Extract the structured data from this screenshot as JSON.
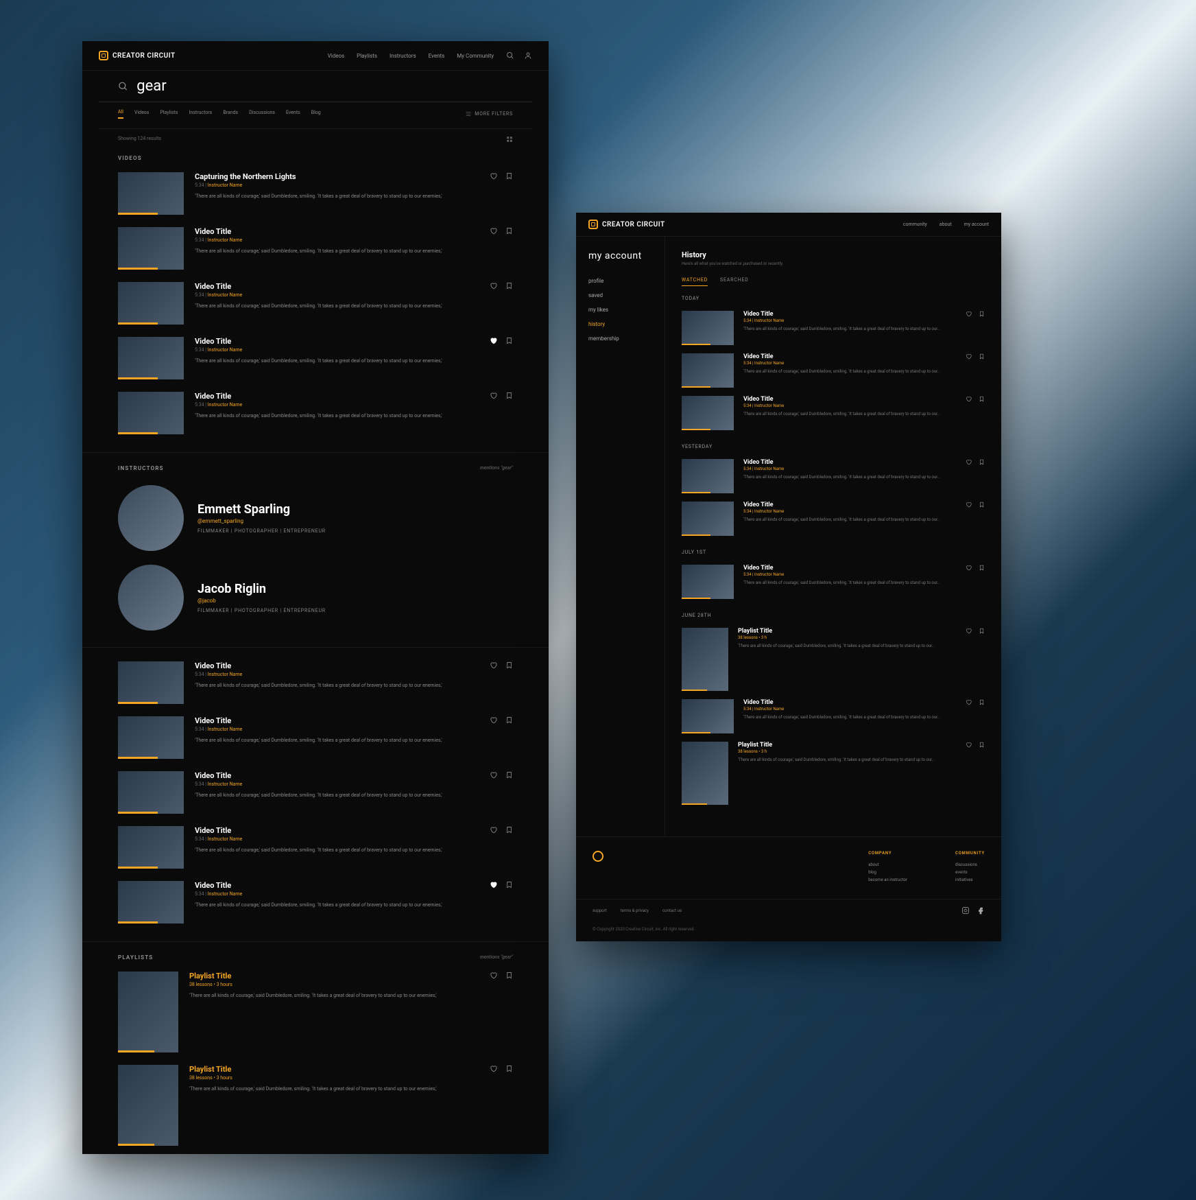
{
  "brand": "CREATOR CIRCUIT",
  "w1": {
    "nav": [
      "Videos",
      "Playlists",
      "Instructors",
      "Events",
      "My Community"
    ],
    "search_value": "gear",
    "tabs": [
      "All",
      "Videos",
      "Playlists",
      "Instructors",
      "Brands",
      "Discussions",
      "Events",
      "Blog"
    ],
    "more_filters": "MORE FILTERS",
    "results_count": "Showing 124 results",
    "sec_videos": "VIDEOS",
    "sec_instructors": "INSTRUCTORS",
    "sec_playlists": "PLAYLISTS",
    "mention": "mentions \"gear\"",
    "desc": "'There are all kinds of courage,' said Dumbledore, smiling. 'It takes a great deal of bravery to stand up to our enemies,'",
    "videos1": [
      {
        "title": "Capturing the Northern Lights",
        "meta_dur": "5:34",
        "meta_by": "Instructor Name",
        "liked": false
      },
      {
        "title": "Video Title",
        "meta_dur": "5:34",
        "meta_by": "Instructor Name",
        "liked": false
      },
      {
        "title": "Video Title",
        "meta_dur": "5:34",
        "meta_by": "Instructor Name",
        "liked": false
      },
      {
        "title": "Video Title",
        "meta_dur": "5:34",
        "meta_by": "Instructor Name",
        "liked": true
      },
      {
        "title": "Video Title",
        "meta_dur": "5:34",
        "meta_by": "Instructor Name",
        "liked": false
      }
    ],
    "instructors": [
      {
        "name": "Emmett Sparling",
        "handle": "@emmett_sparling",
        "tags": "FILMMAKER | PHOTOGRAPHER | ENTREPRENEUR"
      },
      {
        "name": "Jacob Riglin",
        "handle": "@jacob",
        "tags": "FILMMAKER | PHOTOGRAPHER | ENTREPRENEUR"
      }
    ],
    "videos2": [
      {
        "title": "Video Title",
        "meta_dur": "5:34",
        "meta_by": "Instructor Name",
        "liked": false
      },
      {
        "title": "Video Title",
        "meta_dur": "5:34",
        "meta_by": "Instructor Name",
        "liked": false
      },
      {
        "title": "Video Title",
        "meta_dur": "5:34",
        "meta_by": "Instructor Name",
        "liked": false
      },
      {
        "title": "Video Title",
        "meta_dur": "5:34",
        "meta_by": "Instructor Name",
        "liked": false
      },
      {
        "title": "Video Title",
        "meta_dur": "5:34",
        "meta_by": "Instructor Name",
        "liked": true
      }
    ],
    "playlists": [
      {
        "title": "Playlist Title",
        "meta": "38 lessons • 3 hours",
        "liked": false
      },
      {
        "title": "Playlist Title",
        "meta": "38 lessons • 3 hours",
        "liked": false
      }
    ]
  },
  "w2": {
    "nav": [
      "community",
      "about",
      "my account"
    ],
    "sidebar_title": "my account",
    "sidebar": [
      "profile",
      "saved",
      "my likes",
      "history",
      "membership"
    ],
    "sidebar_active": "history",
    "page_title": "History",
    "page_sub": "Here's all what you've watched or purchased or recently.",
    "htabs": [
      "WATCHED",
      "SEARCHED"
    ],
    "desc": "'There are all kinds of courage,' said Dumbledore, smiling. 'It takes a great deal of bravery to stand up to our..",
    "groups": [
      {
        "label": "TODAY",
        "items": [
          {
            "title": "Video Title",
            "meta": "5:34 | Instructor Name",
            "type": "v"
          },
          {
            "title": "Video Title",
            "meta": "5:34 | Instructor Name",
            "type": "v"
          },
          {
            "title": "Video Title",
            "meta": "5:34 | Instructor Name",
            "type": "v"
          }
        ]
      },
      {
        "label": "YESTERDAY",
        "items": [
          {
            "title": "Video Title",
            "meta": "5:34 | Instructor Name",
            "type": "v"
          },
          {
            "title": "Video Title",
            "meta": "5:34 | Instructor Name",
            "type": "v"
          }
        ]
      },
      {
        "label": "JULY 1ST",
        "items": [
          {
            "title": "Video Title",
            "meta": "5:34 | Instructor Name",
            "type": "v"
          }
        ]
      },
      {
        "label": "JUNE 28TH",
        "items": [
          {
            "title": "Playlist Title",
            "meta": "38 lessons • 3 h",
            "type": "p"
          },
          {
            "title": "Video Title",
            "meta": "5:34 | Instructor Name",
            "type": "v"
          },
          {
            "title": "Playlist Title",
            "meta": "38 lessons • 3 h",
            "type": "p"
          }
        ]
      }
    ],
    "footer": {
      "company_h": "COMPANY",
      "community_h": "COMMUNITY",
      "company": [
        "about",
        "blog",
        "become an instructor"
      ],
      "community": [
        "discussions",
        "events",
        "initiatives"
      ]
    },
    "legal": [
      "support",
      "terms & privacy",
      "contact us"
    ],
    "copy": "© Copyright 2020 Creative Circuit, Inc. All right reserved."
  }
}
